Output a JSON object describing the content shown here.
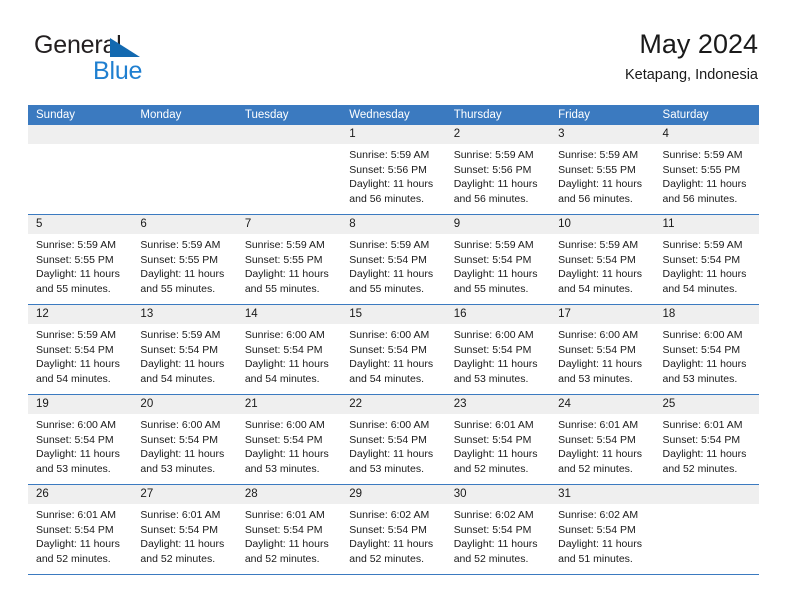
{
  "brand": {
    "line1": "General",
    "line2": "Blue",
    "mark_icon": "blue-triangle-flag-icon",
    "accent_color": "#1f7fd0"
  },
  "header": {
    "title": "May 2024",
    "subtitle": "Ketapang, Indonesia"
  },
  "theme": {
    "header_blue": "#3b7ac0",
    "day_band_gray": "#efefef",
    "text": "#1a1a1a"
  },
  "labels": {
    "sunrise_prefix": "Sunrise: ",
    "sunset_prefix": "Sunset: ",
    "daylight_prefix": "Daylight: "
  },
  "weekdays": [
    "Sunday",
    "Monday",
    "Tuesday",
    "Wednesday",
    "Thursday",
    "Friday",
    "Saturday"
  ],
  "weeks": [
    [
      {
        "empty": true
      },
      {
        "empty": true
      },
      {
        "empty": true
      },
      {
        "day": "1",
        "l1": "Sunrise: 5:59 AM",
        "l2": "Sunset: 5:56 PM",
        "l3": "Daylight: 11 hours",
        "l4": "and 56 minutes."
      },
      {
        "day": "2",
        "l1": "Sunrise: 5:59 AM",
        "l2": "Sunset: 5:56 PM",
        "l3": "Daylight: 11 hours",
        "l4": "and 56 minutes."
      },
      {
        "day": "3",
        "l1": "Sunrise: 5:59 AM",
        "l2": "Sunset: 5:55 PM",
        "l3": "Daylight: 11 hours",
        "l4": "and 56 minutes."
      },
      {
        "day": "4",
        "l1": "Sunrise: 5:59 AM",
        "l2": "Sunset: 5:55 PM",
        "l3": "Daylight: 11 hours",
        "l4": "and 56 minutes."
      }
    ],
    [
      {
        "day": "5",
        "l1": "Sunrise: 5:59 AM",
        "l2": "Sunset: 5:55 PM",
        "l3": "Daylight: 11 hours",
        "l4": "and 55 minutes."
      },
      {
        "day": "6",
        "l1": "Sunrise: 5:59 AM",
        "l2": "Sunset: 5:55 PM",
        "l3": "Daylight: 11 hours",
        "l4": "and 55 minutes."
      },
      {
        "day": "7",
        "l1": "Sunrise: 5:59 AM",
        "l2": "Sunset: 5:55 PM",
        "l3": "Daylight: 11 hours",
        "l4": "and 55 minutes."
      },
      {
        "day": "8",
        "l1": "Sunrise: 5:59 AM",
        "l2": "Sunset: 5:54 PM",
        "l3": "Daylight: 11 hours",
        "l4": "and 55 minutes."
      },
      {
        "day": "9",
        "l1": "Sunrise: 5:59 AM",
        "l2": "Sunset: 5:54 PM",
        "l3": "Daylight: 11 hours",
        "l4": "and 55 minutes."
      },
      {
        "day": "10",
        "l1": "Sunrise: 5:59 AM",
        "l2": "Sunset: 5:54 PM",
        "l3": "Daylight: 11 hours",
        "l4": "and 54 minutes."
      },
      {
        "day": "11",
        "l1": "Sunrise: 5:59 AM",
        "l2": "Sunset: 5:54 PM",
        "l3": "Daylight: 11 hours",
        "l4": "and 54 minutes."
      }
    ],
    [
      {
        "day": "12",
        "l1": "Sunrise: 5:59 AM",
        "l2": "Sunset: 5:54 PM",
        "l3": "Daylight: 11 hours",
        "l4": "and 54 minutes."
      },
      {
        "day": "13",
        "l1": "Sunrise: 5:59 AM",
        "l2": "Sunset: 5:54 PM",
        "l3": "Daylight: 11 hours",
        "l4": "and 54 minutes."
      },
      {
        "day": "14",
        "l1": "Sunrise: 6:00 AM",
        "l2": "Sunset: 5:54 PM",
        "l3": "Daylight: 11 hours",
        "l4": "and 54 minutes."
      },
      {
        "day": "15",
        "l1": "Sunrise: 6:00 AM",
        "l2": "Sunset: 5:54 PM",
        "l3": "Daylight: 11 hours",
        "l4": "and 54 minutes."
      },
      {
        "day": "16",
        "l1": "Sunrise: 6:00 AM",
        "l2": "Sunset: 5:54 PM",
        "l3": "Daylight: 11 hours",
        "l4": "and 53 minutes."
      },
      {
        "day": "17",
        "l1": "Sunrise: 6:00 AM",
        "l2": "Sunset: 5:54 PM",
        "l3": "Daylight: 11 hours",
        "l4": "and 53 minutes."
      },
      {
        "day": "18",
        "l1": "Sunrise: 6:00 AM",
        "l2": "Sunset: 5:54 PM",
        "l3": "Daylight: 11 hours",
        "l4": "and 53 minutes."
      }
    ],
    [
      {
        "day": "19",
        "l1": "Sunrise: 6:00 AM",
        "l2": "Sunset: 5:54 PM",
        "l3": "Daylight: 11 hours",
        "l4": "and 53 minutes."
      },
      {
        "day": "20",
        "l1": "Sunrise: 6:00 AM",
        "l2": "Sunset: 5:54 PM",
        "l3": "Daylight: 11 hours",
        "l4": "and 53 minutes."
      },
      {
        "day": "21",
        "l1": "Sunrise: 6:00 AM",
        "l2": "Sunset: 5:54 PM",
        "l3": "Daylight: 11 hours",
        "l4": "and 53 minutes."
      },
      {
        "day": "22",
        "l1": "Sunrise: 6:00 AM",
        "l2": "Sunset: 5:54 PM",
        "l3": "Daylight: 11 hours",
        "l4": "and 53 minutes."
      },
      {
        "day": "23",
        "l1": "Sunrise: 6:01 AM",
        "l2": "Sunset: 5:54 PM",
        "l3": "Daylight: 11 hours",
        "l4": "and 52 minutes."
      },
      {
        "day": "24",
        "l1": "Sunrise: 6:01 AM",
        "l2": "Sunset: 5:54 PM",
        "l3": "Daylight: 11 hours",
        "l4": "and 52 minutes."
      },
      {
        "day": "25",
        "l1": "Sunrise: 6:01 AM",
        "l2": "Sunset: 5:54 PM",
        "l3": "Daylight: 11 hours",
        "l4": "and 52 minutes."
      }
    ],
    [
      {
        "day": "26",
        "l1": "Sunrise: 6:01 AM",
        "l2": "Sunset: 5:54 PM",
        "l3": "Daylight: 11 hours",
        "l4": "and 52 minutes."
      },
      {
        "day": "27",
        "l1": "Sunrise: 6:01 AM",
        "l2": "Sunset: 5:54 PM",
        "l3": "Daylight: 11 hours",
        "l4": "and 52 minutes."
      },
      {
        "day": "28",
        "l1": "Sunrise: 6:01 AM",
        "l2": "Sunset: 5:54 PM",
        "l3": "Daylight: 11 hours",
        "l4": "and 52 minutes."
      },
      {
        "day": "29",
        "l1": "Sunrise: 6:02 AM",
        "l2": "Sunset: 5:54 PM",
        "l3": "Daylight: 11 hours",
        "l4": "and 52 minutes."
      },
      {
        "day": "30",
        "l1": "Sunrise: 6:02 AM",
        "l2": "Sunset: 5:54 PM",
        "l3": "Daylight: 11 hours",
        "l4": "and 52 minutes."
      },
      {
        "day": "31",
        "l1": "Sunrise: 6:02 AM",
        "l2": "Sunset: 5:54 PM",
        "l3": "Daylight: 11 hours",
        "l4": "and 51 minutes."
      },
      {
        "empty": true
      }
    ]
  ]
}
